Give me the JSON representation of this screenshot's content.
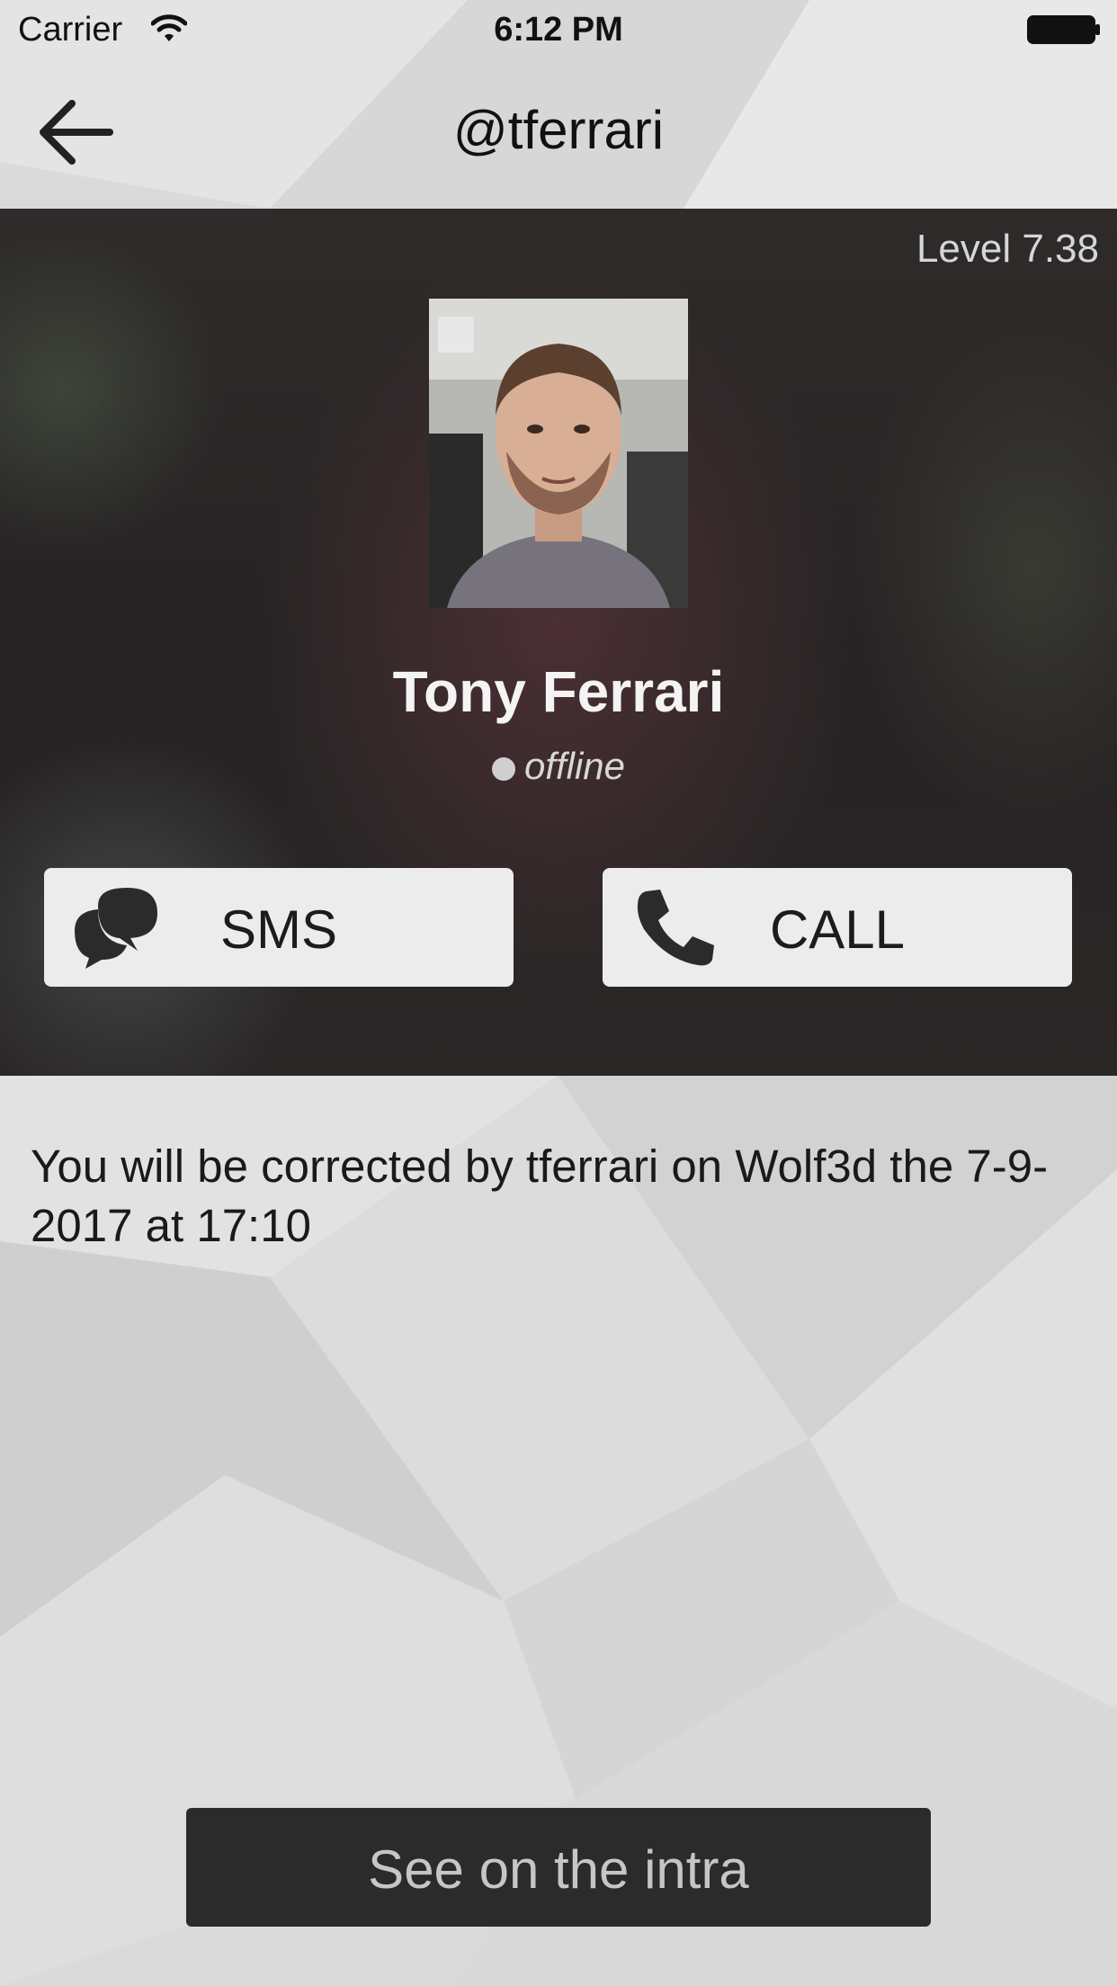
{
  "status_bar": {
    "carrier": "Carrier",
    "time": "6:12 PM",
    "wifi_icon": "wifi-icon",
    "battery_icon": "battery-icon"
  },
  "nav": {
    "back_icon": "arrow-left-icon",
    "title": "@tferrari"
  },
  "profile": {
    "level": "Level 7.38",
    "name": "Tony Ferrari",
    "status": "offline",
    "status_color": "#cfcfcf"
  },
  "actions": {
    "sms_label": "SMS",
    "sms_icon": "chat-bubbles-icon",
    "call_label": "CALL",
    "call_icon": "phone-icon"
  },
  "correction": {
    "text": "You will be corrected by tferrari on Wolf3d the 7-9-2017 at 17:10"
  },
  "footer": {
    "intra_button_label": "See on the intra"
  },
  "colors": {
    "header_bg": "#2a2727",
    "button_bg": "#ececec",
    "intra_button_bg": "#2b2b2b"
  }
}
